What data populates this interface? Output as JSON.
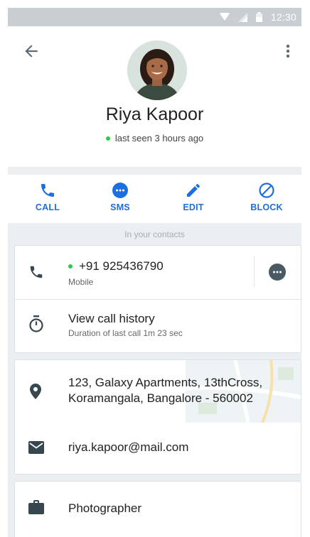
{
  "status_bar": {
    "time": "12:30"
  },
  "contact": {
    "name": "Riya Kapoor",
    "presence": "last seen 3 hours ago"
  },
  "actions": {
    "call": "CALL",
    "sms": "SMS",
    "edit": "EDIT",
    "block": "BLOCK"
  },
  "section_label": "In your contacts",
  "phone": {
    "number": "+91 925436790",
    "type": "Mobile"
  },
  "call_history": {
    "title": "View call history",
    "subtitle": "Duration of last call 1m 23 sec"
  },
  "address": {
    "line1": "123, Galaxy Apartments, 13thCross,",
    "line2": "Koramangala, Bangalore - 560002"
  },
  "email": "riya.kapoor@mail.com",
  "occupation": "Photographer",
  "colors": {
    "accent": "#1d6fe0",
    "icon_dark": "#37474f",
    "online": "#2ecc40"
  },
  "icons": [
    "back-arrow-icon",
    "more-vert-icon",
    "phone-icon",
    "sms-icon",
    "edit-icon",
    "block-icon",
    "message-icon",
    "timer-icon",
    "location-icon",
    "email-icon",
    "briefcase-icon"
  ]
}
